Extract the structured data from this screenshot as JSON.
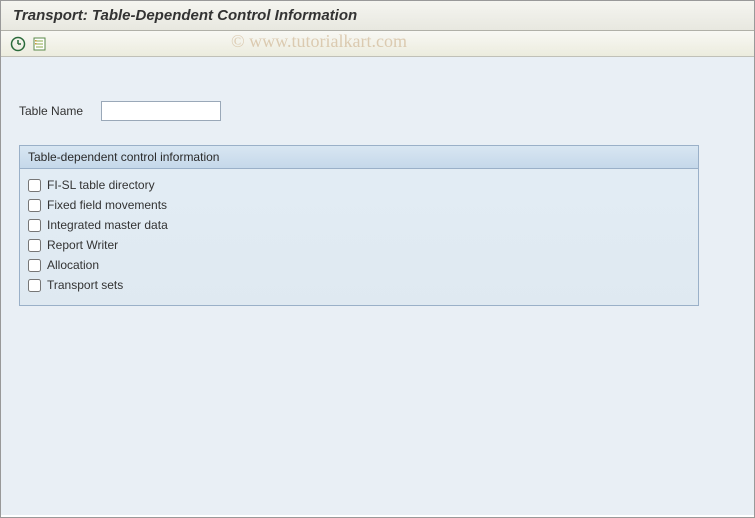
{
  "title": "Transport: Table-Dependent Control Information",
  "watermark": "© www.tutorialkart.com",
  "toolbar": {
    "execute_icon": "execute-icon",
    "variant_icon": "variant-icon"
  },
  "fields": {
    "table_name_label": "Table Name",
    "table_name_value": ""
  },
  "groupbox": {
    "title": "Table-dependent control information",
    "checkboxes": [
      {
        "label": "FI-SL table directory",
        "checked": false
      },
      {
        "label": "Fixed field movements",
        "checked": false
      },
      {
        "label": "Integrated master data",
        "checked": false
      },
      {
        "label": "Report Writer",
        "checked": false
      },
      {
        "label": "Allocation",
        "checked": false
      },
      {
        "label": "Transport sets",
        "checked": false
      }
    ]
  }
}
